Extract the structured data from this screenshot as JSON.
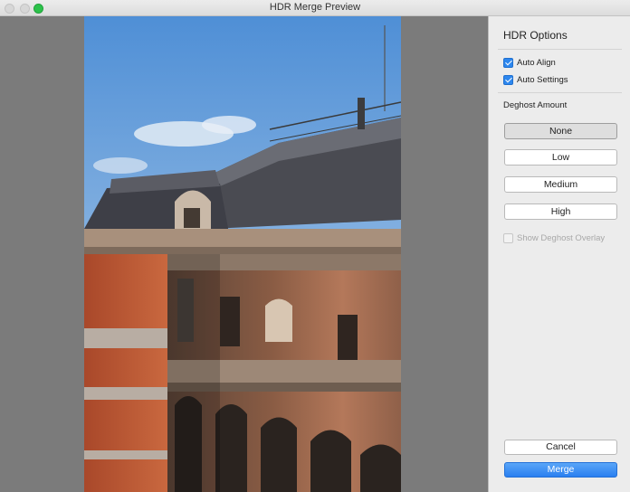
{
  "window": {
    "title": "HDR Merge Preview"
  },
  "panel": {
    "title": "HDR Options",
    "auto_align": {
      "label": "Auto Align",
      "checked": true
    },
    "auto_settings": {
      "label": "Auto Settings",
      "checked": true
    },
    "deghost_label": "Deghost Amount",
    "deghost_options": [
      "None",
      "Low",
      "Medium",
      "High"
    ],
    "deghost_selected": "None",
    "show_overlay": {
      "label": "Show Deghost Overlay",
      "checked": false,
      "enabled": false
    },
    "cancel_label": "Cancel",
    "merge_label": "Merge"
  },
  "colors": {
    "accent": "#2d87ee",
    "merge_button": "#3b8ff3",
    "zoom": "#2cc24a"
  }
}
